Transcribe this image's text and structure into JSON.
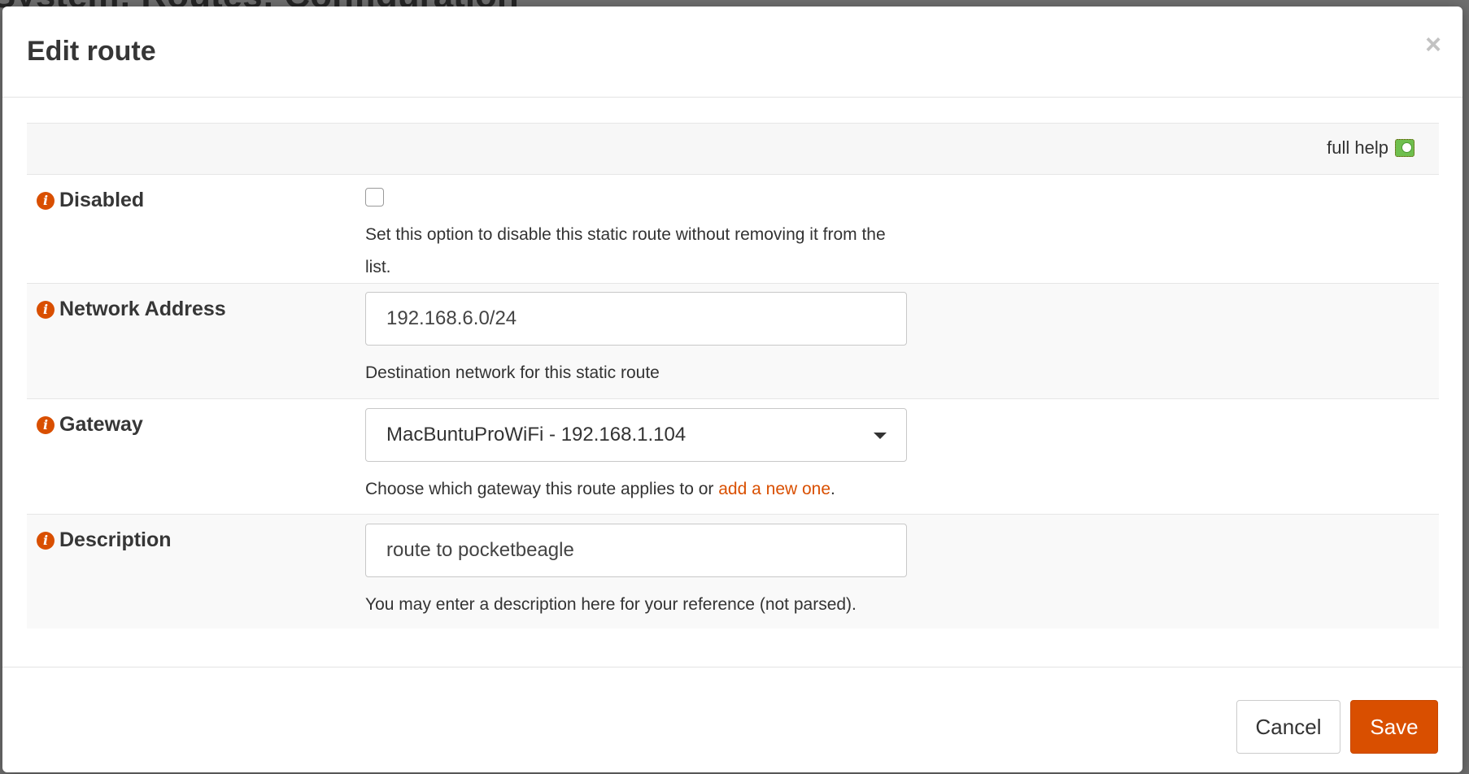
{
  "background": {
    "page_title": "System: Routes: Configuration"
  },
  "modal": {
    "title": "Edit route",
    "close_symbol": "×",
    "full_help_label": "full help",
    "full_help_enabled": true
  },
  "form": {
    "disabled": {
      "label": "Disabled",
      "checked": false,
      "help": "Set this option to disable this static route without removing it from the list."
    },
    "network": {
      "label": "Network Address",
      "value": "192.168.6.0/24",
      "help": "Destination network for this static route"
    },
    "gateway": {
      "label": "Gateway",
      "selected": "MacBuntuProWiFi - 192.168.1.104",
      "help_prefix": "Choose which gateway this route applies to or ",
      "help_link": "add a new one",
      "help_suffix": "."
    },
    "description": {
      "label": "Description",
      "value": "route to pocketbeagle",
      "help": "You may enter a description here for your reference (not parsed)."
    }
  },
  "footer": {
    "cancel_label": "Cancel",
    "save_label": "Save"
  },
  "colors": {
    "accent": "#d94f00",
    "toggle_on": "#6fbf4e"
  }
}
